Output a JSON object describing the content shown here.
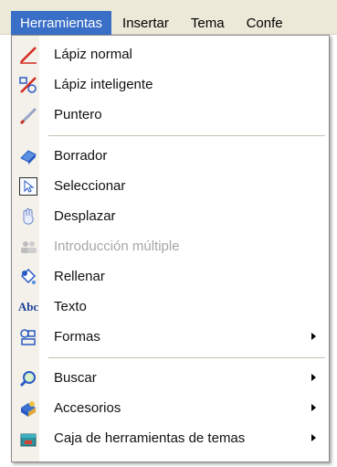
{
  "menubar": {
    "items": [
      "Herramientas",
      "Insertar",
      "Tema",
      "Confe"
    ]
  },
  "menu": {
    "groups": [
      [
        {
          "label": "Lápiz normal",
          "icon": "pencil-icon",
          "disabled": false,
          "submenu": false
        },
        {
          "label": "Lápiz inteligente",
          "icon": "smart-pencil-icon",
          "disabled": false,
          "submenu": false
        },
        {
          "label": "Puntero",
          "icon": "pointer-pen-icon",
          "disabled": false,
          "submenu": false
        }
      ],
      [
        {
          "label": "Borrador",
          "icon": "eraser-icon",
          "disabled": false,
          "submenu": false
        },
        {
          "label": "Seleccionar",
          "icon": "select-cursor-icon",
          "disabled": false,
          "submenu": false
        },
        {
          "label": "Desplazar",
          "icon": "hand-icon",
          "disabled": false,
          "submenu": false
        },
        {
          "label": "Introducción múltiple",
          "icon": "multi-user-icon",
          "disabled": true,
          "submenu": false
        },
        {
          "label": "Rellenar",
          "icon": "fill-icon",
          "disabled": false,
          "submenu": false
        },
        {
          "label": "Texto",
          "icon": "text-icon",
          "disabled": false,
          "submenu": false
        },
        {
          "label": "Formas",
          "icon": "shapes-icon",
          "disabled": false,
          "submenu": true
        }
      ],
      [
        {
          "label": "Buscar",
          "icon": "search-icon",
          "disabled": false,
          "submenu": true
        },
        {
          "label": "Accesorios",
          "icon": "accessories-icon",
          "disabled": false,
          "submenu": true
        },
        {
          "label": "Caja de herramientas de temas",
          "icon": "toolbox-icon",
          "disabled": false,
          "submenu": true
        }
      ]
    ],
    "text_icon_glyph": "Abc"
  },
  "colors": {
    "menubar_active": "#3a6fc7",
    "disabled_text": "#a6a6a6"
  }
}
